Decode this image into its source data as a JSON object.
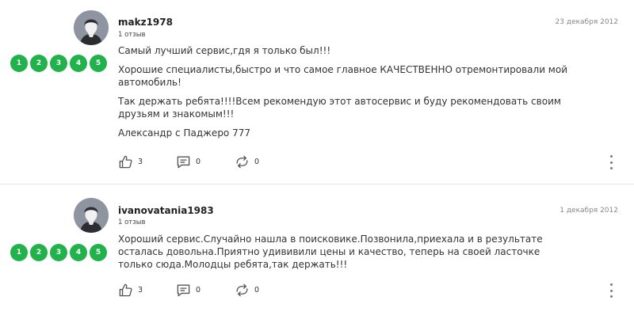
{
  "reviews": [
    {
      "username": "makz1978",
      "review_count": "1 отзыв",
      "date": "23 декабря 2012",
      "rating_labels": [
        "1",
        "2",
        "3",
        "4",
        "5"
      ],
      "paragraphs": [
        "Самый лучший сервис,гдя я только был!!!",
        "Хорошие специалисты,быстро и что самое главное КАЧЕСТВЕННО отремонтировали мой автомобиль!",
        "Так держать ребята!!!!Всем рекомендую этот автосервис и буду рекомендовать своим друзьям и знакомым!!!",
        "Александр с Паджеро 777"
      ],
      "likes": "3",
      "comments": "0",
      "shares": "0"
    },
    {
      "username": "ivanovatania1983",
      "review_count": "1 отзыв",
      "date": "1 декабря 2012",
      "rating_labels": [
        "1",
        "2",
        "3",
        "4",
        "5"
      ],
      "paragraphs": [
        "Хороший сервис.Случайно нашла в поисковике.Позвонила,приехала и в результате осталась довольна.Приятно удививили цены и качество, теперь на своей ласточке только сюда.Молодцы ребята,так держать!!!"
      ],
      "likes": "3",
      "comments": "0",
      "shares": "0"
    }
  ],
  "colors": {
    "rating_green": "#22b24c",
    "avatar_bg": "#8e95a0",
    "divider": "#e6e6e6"
  },
  "icons": {
    "avatar": "user-avatar-icon",
    "like": "thumbs-up-icon",
    "comment": "comment-icon",
    "share": "share-icon",
    "more": "more-vertical-icon"
  }
}
